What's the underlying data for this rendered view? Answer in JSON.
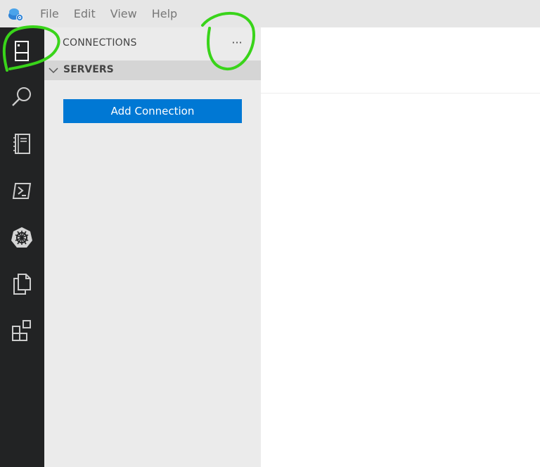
{
  "menu": {
    "items": [
      "File",
      "Edit",
      "View",
      "Help"
    ]
  },
  "activity_bar": {
    "items": [
      {
        "icon": "connections-icon"
      },
      {
        "icon": "search-icon"
      },
      {
        "icon": "notebook-icon"
      },
      {
        "icon": "terminal-icon"
      },
      {
        "icon": "kubernetes-icon"
      },
      {
        "icon": "copy-icon"
      },
      {
        "icon": "extensions-icon"
      }
    ]
  },
  "sidebar": {
    "title": "CONNECTIONS",
    "more_label": "···",
    "section": {
      "title": "SERVERS",
      "add_button_label": "Add Connection"
    }
  },
  "colors": {
    "activity_bar_bg": "#222324",
    "sidebar_bg": "#ebebeb",
    "section_header_bg": "#d5d5d5",
    "button_bg": "#0078d4",
    "annotation": "#39d41a"
  }
}
